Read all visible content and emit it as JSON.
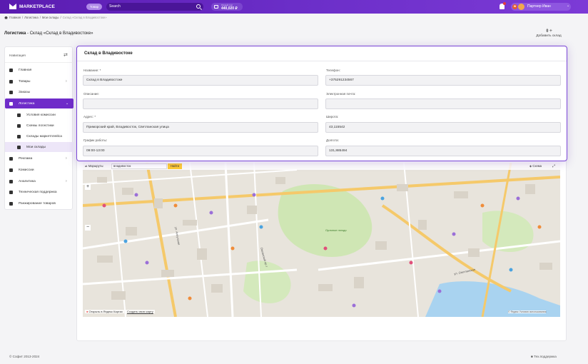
{
  "header": {
    "logo": "MARKETPLACE",
    "pill": "Товар",
    "search_placeholder": "Search",
    "wallet_label": "Личный счет",
    "wallet_value": "440,020 ₽",
    "user_badge": "W",
    "user_name": "Партнер Иван",
    "user_chevron": "⌄"
  },
  "breadcrumb": {
    "items": [
      "Главная",
      "Логистика",
      "Мои склады"
    ],
    "current": "Склад «Склад в Владивостоке»",
    "separator": "/"
  },
  "page": {
    "title_bold": "Логистика",
    "title_rest": " - Склад «Склад в Владивостоке»",
    "add_label": "Добавить склад",
    "add_icon": "⇟+"
  },
  "sidebar": {
    "heading": "Навигация",
    "switch_icon": "⇄",
    "items": [
      {
        "label": "Главная",
        "icon": "home-icon"
      },
      {
        "label": "Товары",
        "icon": "box-icon",
        "chevron": "›"
      },
      {
        "label": "Заказы",
        "icon": "cart-icon"
      },
      {
        "label": "Логистика",
        "icon": "truck-icon",
        "chevron": "⌄"
      },
      {
        "label": "Условия комиссии",
        "icon": "tag-icon"
      },
      {
        "label": "Схемы логистики",
        "icon": "list-icon"
      },
      {
        "label": "Склады маркетплейса",
        "icon": "building-icon"
      },
      {
        "label": "Мои склады",
        "icon": "warehouse-icon"
      },
      {
        "label": "Реклама",
        "icon": "megaphone-icon",
        "chevron": "›"
      },
      {
        "label": "Комиссии",
        "icon": "percent-icon"
      },
      {
        "label": "Аналитика",
        "icon": "chart-icon",
        "chevron": "›"
      },
      {
        "label": "Техническая поддержка",
        "icon": "support-icon"
      },
      {
        "label": "Ранжирование товаров",
        "icon": "ranking-icon"
      }
    ]
  },
  "form": {
    "title": "Склад в Владивостоке",
    "name_label": "Название: *",
    "name_value": "Склад в Владивостоке",
    "phone_label": "Телефон:",
    "phone_value": "+375291234567",
    "desc_label": "Описание:",
    "desc_value": "",
    "email_label": "Электронная почта:",
    "email_value": "",
    "addr_label": "Адрес: *",
    "addr_value": "Приморский край, Владивосток, Светланская улица",
    "lat_label": "Широта:",
    "lat_value": "43,115542",
    "hours_label": "График работы:",
    "hours_value": "09:00-13:00",
    "lon_label": "Долгота:",
    "lon_value": "131,885494"
  },
  "map": {
    "routes_label": "Маршруты",
    "search_value": "владивосток",
    "find_button": "Найти",
    "layers_label": "Схема",
    "zoom_in": "+",
    "zoom_out": "−",
    "open_yandex": "Открыть в Яндекс Картах",
    "create_map": "Создать свою карту",
    "copyright": "© Яндекс Условия использования",
    "street1": "ул. Светланская",
    "street2": "ул. Алеутская",
    "street3": "Океанский пр-т",
    "park": "Орлиное гнездо"
  },
  "footer": {
    "copyright": "© Софит 2013-2024",
    "support": "Тех.поддержка"
  }
}
